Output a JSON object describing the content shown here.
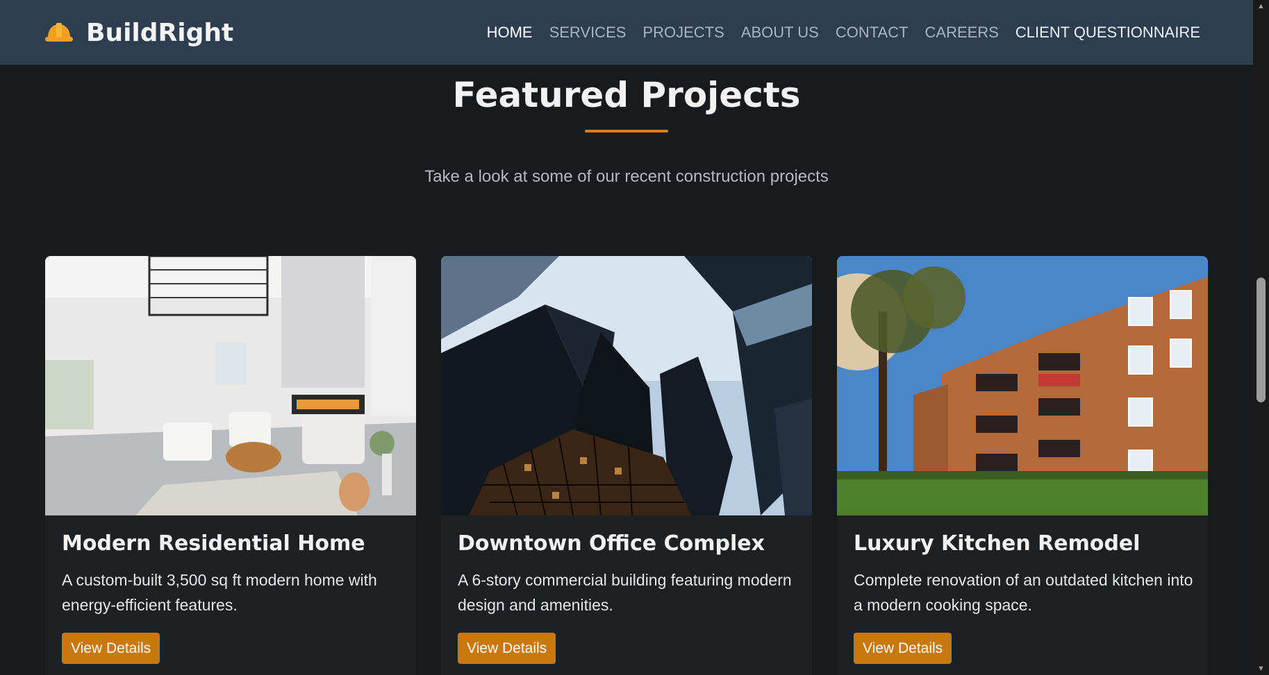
{
  "brand": {
    "name": "BuildRight",
    "icon": "hardhat-icon"
  },
  "nav": {
    "items": [
      {
        "label": "HOME",
        "state": "active"
      },
      {
        "label": "SERVICES",
        "state": "normal"
      },
      {
        "label": "PROJECTS",
        "state": "normal"
      },
      {
        "label": "ABOUT US",
        "state": "normal"
      },
      {
        "label": "CONTACT",
        "state": "normal"
      },
      {
        "label": "CAREERS",
        "state": "normal"
      },
      {
        "label": "CLIENT QUESTIONNAIRE",
        "state": "emphasized"
      }
    ]
  },
  "section": {
    "title": "Featured Projects",
    "subtitle": "Take a look at some of our recent construction projects"
  },
  "projects": [
    {
      "title": "Modern Residential Home",
      "description": "A custom-built 3,500 sq ft modern home with energy-efficient features.",
      "button": "View Details",
      "image": "bright-living-room-photo"
    },
    {
      "title": "Downtown Office Complex",
      "description": "A 6-story commercial building featuring modern design and amenities.",
      "button": "View Details",
      "image": "skyscrapers-from-below-photo"
    },
    {
      "title": "Luxury Kitchen Remodel",
      "description": "Complete renovation of an outdated kitchen into a modern cooking space.",
      "button": "View Details",
      "image": "brick-apartment-building-photo"
    }
  ],
  "colors": {
    "page_bg": "#181b1e",
    "navbar_bg": "#2c3e50",
    "accent": "#c9780b",
    "card_bg": "#1e2124"
  }
}
